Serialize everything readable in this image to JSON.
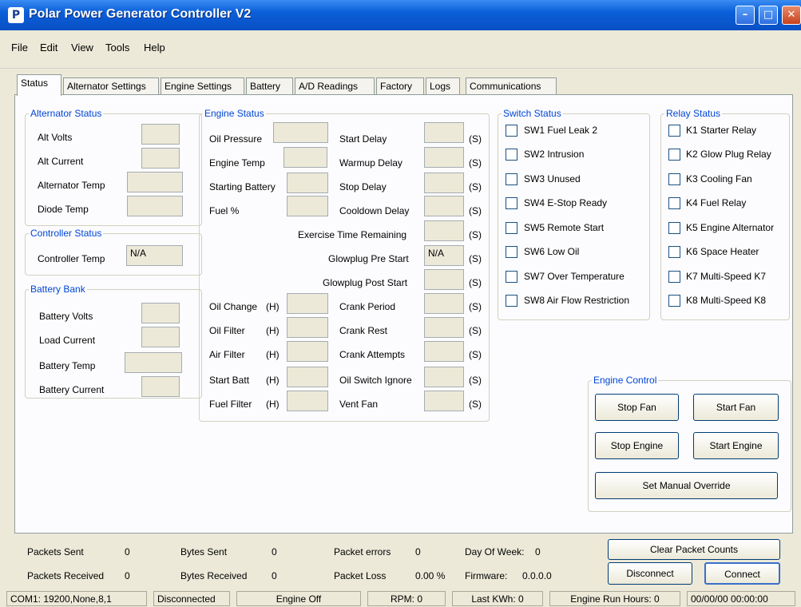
{
  "window": {
    "title": "Polar Power Generator Controller V2",
    "min": "–",
    "max": "□",
    "close": "✕"
  },
  "menu": [
    "File",
    "Edit",
    "View",
    "Tools",
    "Help"
  ],
  "tabs": [
    "Status",
    "Alternator Settings",
    "Engine Settings",
    "Battery",
    "A/D Readings",
    "Factory",
    "Logs",
    "Communications"
  ],
  "alternator_status": {
    "title": "Alternator Status",
    "labels": [
      "Alt Volts",
      "Alt Current",
      "Alternator Temp",
      "Diode Temp"
    ]
  },
  "controller_status": {
    "title": "Controller Status",
    "label": "Controller Temp",
    "value": "N/A"
  },
  "battery_bank": {
    "title": "Battery Bank",
    "labels": [
      "Battery Volts",
      "Load Current",
      "Battery Temp",
      "Battery Current"
    ]
  },
  "engine_status": {
    "title": "Engine Status",
    "left_labels": [
      "Oil Pressure",
      "Engine Temp",
      "Starting Battery",
      "Fuel %"
    ],
    "right_labels": [
      "Start Delay",
      "Warmup Delay",
      "Stop Delay",
      "Cooldown Delay"
    ],
    "exercise_label": "Exercise Time Remaining",
    "glowplug_pre_label": "Glowplug Pre Start",
    "glowplug_pre_value": "N/A",
    "glowplug_post_label": "Glowplug Post Start",
    "maint_labels": [
      "Oil Change",
      "Oil Filter",
      "Air Filter",
      "Start Batt",
      "Fuel Filter"
    ],
    "maint_unit": "(H)",
    "crank_labels": [
      "Crank Period",
      "Crank Rest",
      "Crank Attempts",
      "Oil Switch Ignore",
      "Vent Fan"
    ],
    "sec_unit": "(S)"
  },
  "switch_status": {
    "title": "Switch Status",
    "items": [
      "SW1 Fuel Leak 2",
      "SW2 Intrusion",
      "SW3 Unused",
      "SW4 E-Stop Ready",
      "SW5 Remote Start",
      "SW6 Low Oil",
      "SW7 Over Temperature",
      "SW8 Air Flow Restriction"
    ]
  },
  "relay_status": {
    "title": "Relay Status",
    "items": [
      "K1 Starter Relay",
      "K2 Glow Plug Relay",
      "K3 Cooling Fan",
      "K4 Fuel Relay",
      "K5 Engine Alternator",
      "K6 Space Heater",
      "K7 Multi-Speed K7",
      "K8 Multi-Speed K8"
    ]
  },
  "engine_control": {
    "title": "Engine Control",
    "stop_fan": "Stop Fan",
    "start_fan": "Start Fan",
    "stop_engine": "Stop Engine",
    "start_engine": "Start Engine",
    "manual_override": "Set Manual Override"
  },
  "packets": {
    "sent_label": "Packets Sent",
    "sent_value": "0",
    "received_label": "Packets Received",
    "received_value": "0",
    "bytes_sent_label": "Bytes Sent",
    "bytes_sent_value": "0",
    "bytes_received_label": "Bytes Received",
    "bytes_received_value": "0",
    "errors_label": "Packet errors",
    "errors_value": "0",
    "loss_label": "Packet Loss",
    "loss_value": "0.00 %",
    "dow_label": "Day Of Week:",
    "dow_value": "0",
    "firmware_label": "Firmware:",
    "firmware_value": "0.0.0.0",
    "clear_button": "Clear Packet Counts",
    "disconnect_button": "Disconnect",
    "connect_button": "Connect"
  },
  "statusbar": [
    "COM1: 19200,None,8,1",
    "Disconnected",
    "Engine Off",
    "RPM: 0",
    "Last KWh: 0",
    "Engine Run Hours: 0",
    "00/00/00 00:00:00"
  ]
}
